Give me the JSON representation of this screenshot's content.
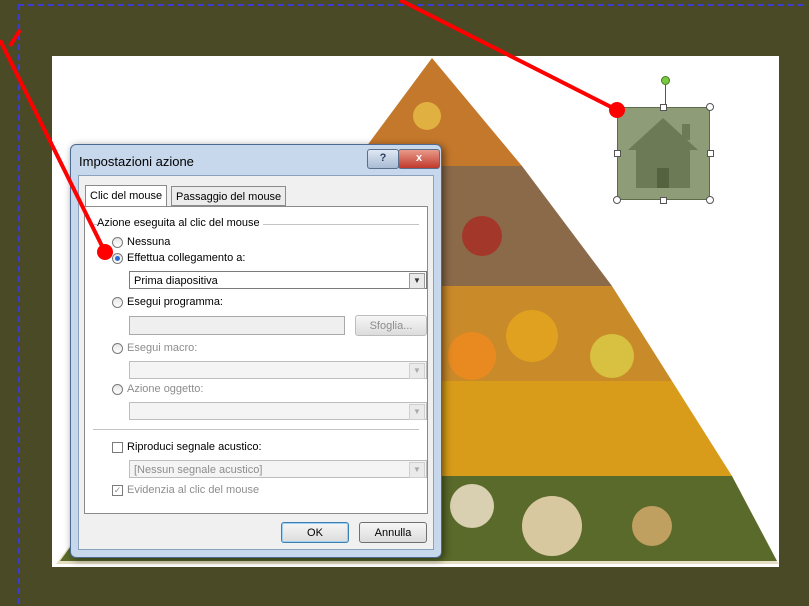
{
  "dialog": {
    "title": "Impostazioni azione",
    "help_label": "?",
    "close_label": "x",
    "tabs": [
      "Clic del mouse",
      "Passaggio del mouse"
    ],
    "group_label": "Azione eseguita al clic del mouse",
    "options": {
      "none": "Nessuna",
      "hyperlink": "Effettua collegamento a:",
      "hyperlink_value": "Prima diapositiva",
      "run_program": "Esegui programma:",
      "browse": "Sfoglia...",
      "run_macro": "Esegui macro:",
      "object_action": "Azione oggetto:"
    },
    "play_sound": "Riproduci segnale acustico:",
    "sound_value": "[Nessun segnale acustico]",
    "highlight": "Evidenzia al clic del mouse",
    "ok": "OK",
    "cancel": "Annulla"
  },
  "colors": {
    "slide_bg": "#4a4a26",
    "arrow": "#ff0000",
    "home_fill": "#8f9c78"
  }
}
